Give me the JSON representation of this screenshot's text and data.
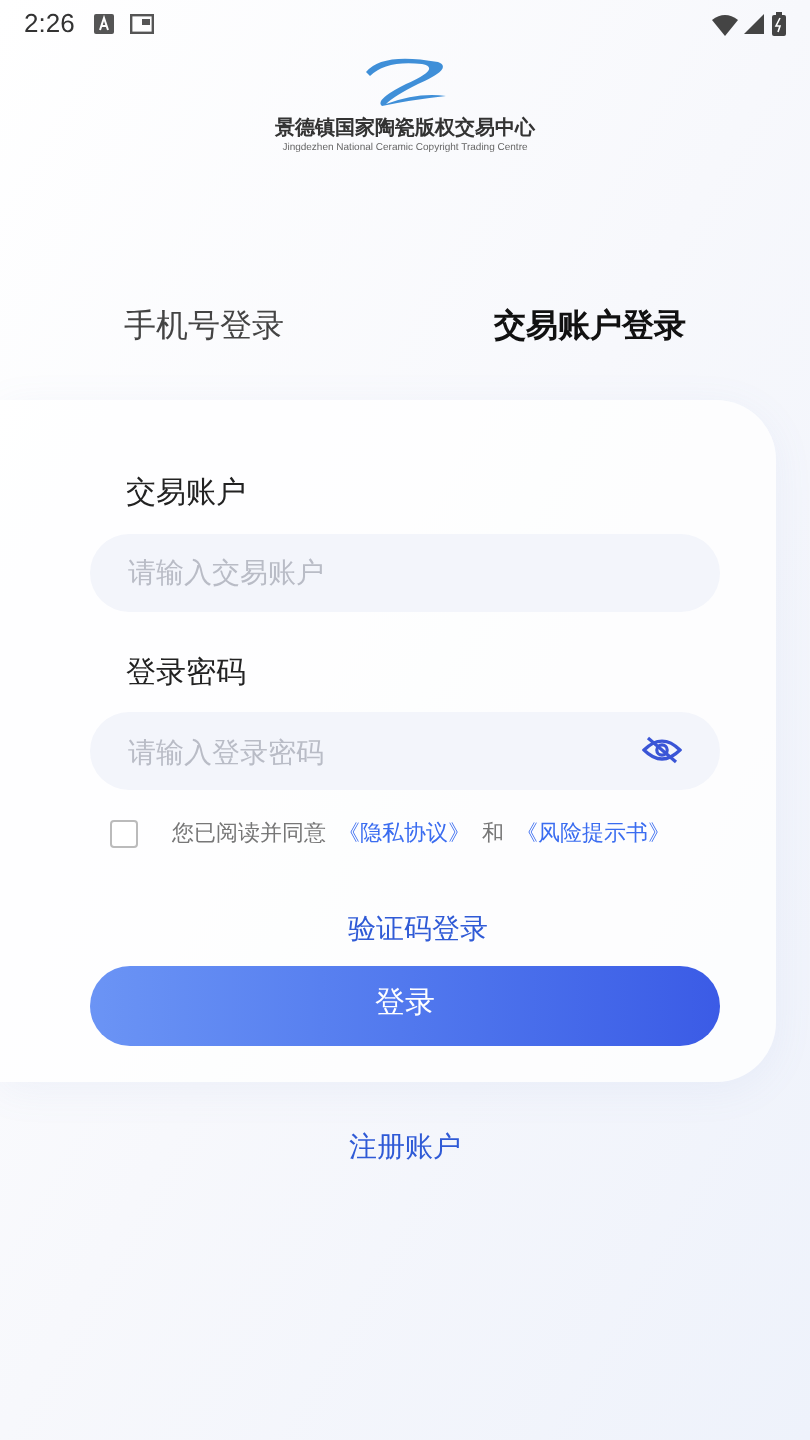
{
  "status_bar": {
    "time": "2:26"
  },
  "logo": {
    "name": "景德镇国家陶瓷版权交易中心",
    "subtitle": "Jingdezhen National Ceramic Copyright Trading Centre"
  },
  "tabs": [
    {
      "label": "手机号登录",
      "selected": false
    },
    {
      "label": "交易账户登录",
      "selected": true
    }
  ],
  "fields": [
    {
      "label": "交易账户",
      "placeholder": "请输入交易账户",
      "kind": "text"
    },
    {
      "label": "登录密码",
      "placeholder": "请输入登录密码",
      "kind": "password"
    }
  ],
  "agreement": {
    "checked": false,
    "prefix": "您已阅读并同意",
    "link_1": "《隐私协议》",
    "joiner": "和",
    "link_2": "《风险提示书》"
  },
  "code_login": "验证码登录",
  "login_button": "登录",
  "register": "注册账户"
}
